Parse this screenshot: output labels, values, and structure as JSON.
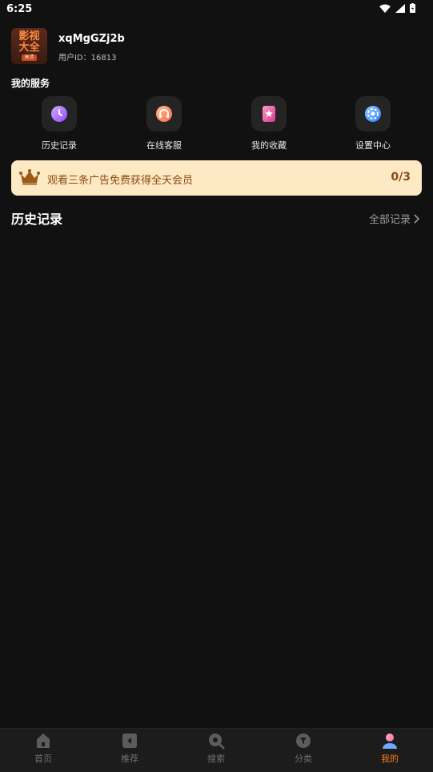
{
  "status": {
    "time": "6:25"
  },
  "profile": {
    "logo_line1": "影视",
    "logo_line2": "大全",
    "logo_sub": "高清",
    "username": "xqMgGZj2b",
    "user_id": "用户ID：16813"
  },
  "services": {
    "title": "我的服务",
    "items": [
      {
        "label": "历史记录",
        "icon": "clock-icon",
        "color": "#b57cff"
      },
      {
        "label": "在线客服",
        "icon": "headset-icon",
        "color": "#ff9a6a"
      },
      {
        "label": "我的收藏",
        "icon": "bookmark-star-icon",
        "color": "#ff5fa0"
      },
      {
        "label": "设置中心",
        "icon": "gear-icon",
        "color": "#4aa3ff"
      }
    ]
  },
  "banner": {
    "text": "观看三条广告免费获得全天会员",
    "count": "0/3",
    "icon": "crown-icon"
  },
  "history": {
    "title": "历史记录",
    "all_label": "全部记录"
  },
  "tabbar": {
    "items": [
      {
        "label": "首页",
        "icon": "home-icon"
      },
      {
        "label": "推荐",
        "icon": "play-square-icon"
      },
      {
        "label": "搜索",
        "icon": "search-icon"
      },
      {
        "label": "分类",
        "icon": "filter-icon"
      },
      {
        "label": "我的",
        "icon": "user-icon",
        "active": true
      }
    ]
  },
  "colors": {
    "accent": "#ff7a1a",
    "banner_bg": "#fde9c3",
    "banner_text": "#8a4a12"
  }
}
